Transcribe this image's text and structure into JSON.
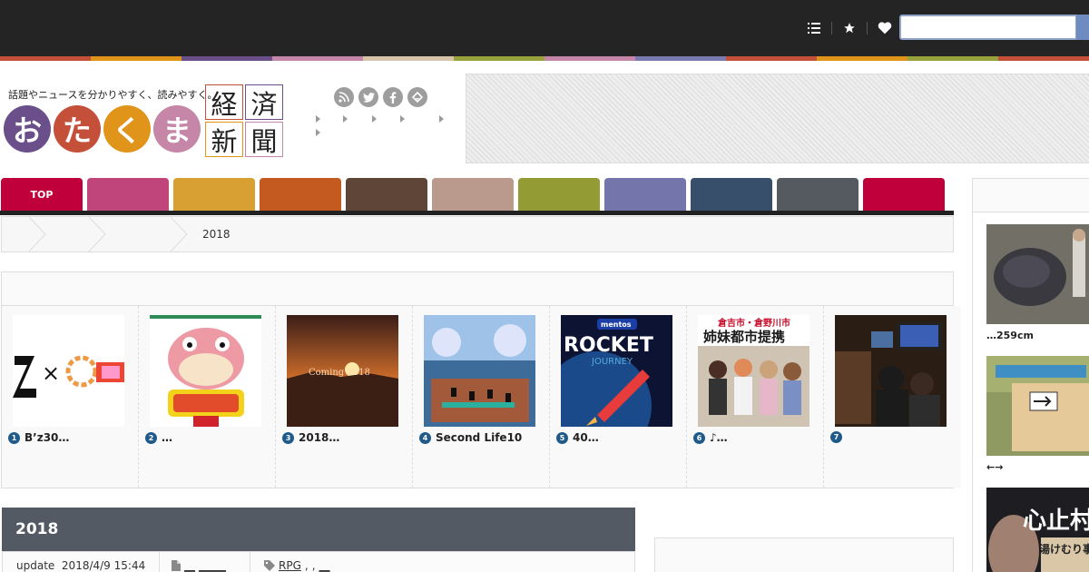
{
  "header": {
    "tagline": "話題やニュースを分かりやすく、読みやすく。",
    "logo_chars": [
      "お",
      "た",
      "く",
      "ま"
    ],
    "logo_colors": [
      "#6b4f8a",
      "#c4503a",
      "#e0941a",
      "#c586a8"
    ],
    "kanji": [
      "経",
      "済",
      "新",
      "聞"
    ],
    "kanji_border_colors": [
      "#c4503a",
      "#6b4f8a",
      "#e0941a",
      "#c586a8"
    ],
    "top_icons": [
      "list-icon",
      "star-icon",
      "heart-icon"
    ],
    "social_icons": [
      "rss-icon",
      "twitter-icon",
      "facebook-icon",
      "feedly-icon"
    ],
    "search": {
      "placeholder": ""
    }
  },
  "stripe_colors": [
    "#c4503a",
    "#e0941a",
    "#6b4f8a",
    "#c586a8",
    "#d7c3a8",
    "#97a23c",
    "#c586a8",
    "#7a7ab0",
    "#c4503a",
    "#e0941a",
    "#97a23c",
    "#c4503a"
  ],
  "nav": {
    "tabs": [
      {
        "label": "TOP",
        "color": "#c0003a"
      },
      {
        "label": "",
        "color": "#c0457a"
      },
      {
        "label": "",
        "color": "#d8a032"
      },
      {
        "label": "",
        "color": "#c45a20"
      },
      {
        "label": "",
        "color": "#5e4537"
      },
      {
        "label": "",
        "color": "#b99a8c"
      },
      {
        "label": "",
        "color": "#939b35"
      },
      {
        "label": "",
        "color": "#7476ab"
      },
      {
        "label": "",
        "color": "#384f6b"
      },
      {
        "label": "",
        "color": "#545a5f"
      },
      {
        "label": "",
        "color": "#c0003a"
      }
    ]
  },
  "breadcrumb": {
    "current": "2018"
  },
  "ranking": {
    "items": [
      {
        "num": "1",
        "label": "B’z30…"
      },
      {
        "num": "2",
        "label": "…"
      },
      {
        "num": "3",
        "label": "2018…"
      },
      {
        "num": "4",
        "label": "Second Life10"
      },
      {
        "num": "5",
        "label": "40…"
      },
      {
        "num": "6",
        "label": "♪…"
      },
      {
        "num": "7",
        "label": ""
      }
    ],
    "thumb_texts": {
      "t1": "×",
      "t3": "Coming 2018",
      "t5_brand": "mentos",
      "t5_title": "ROCKET",
      "t5_sub": "JOURNEY",
      "t6_top": "倉吉市・倉野川市",
      "t6_main": "姉妹都市提携"
    }
  },
  "article": {
    "title": "2018",
    "update_label": "update",
    "update_date": "2018/4/9 15:44",
    "file_links": [
      "__",
      "_____"
    ],
    "tags": [
      "RPG",
      ",",
      ",",
      "__"
    ]
  },
  "sidebar": {
    "captions": [
      "…259cm",
      "←→"
    ],
    "thumb3_title": "心止村",
    "thumb3_sub": "湯けむり事件簿"
  }
}
